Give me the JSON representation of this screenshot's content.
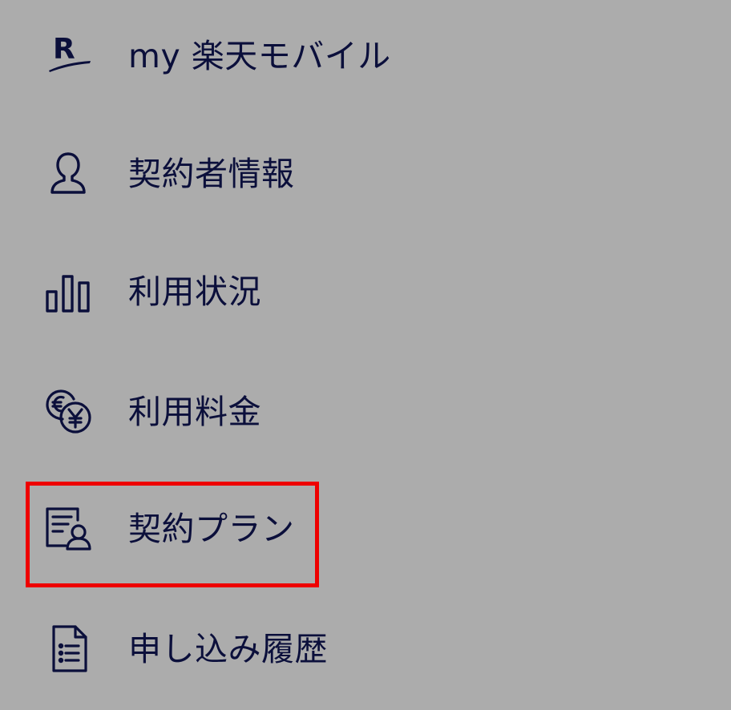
{
  "menu": {
    "items": [
      {
        "label": "my 楽天モバイル",
        "icon": "rakuten-logo-icon"
      },
      {
        "label": "契約者情報",
        "icon": "person-icon"
      },
      {
        "label": "利用状況",
        "icon": "bar-chart-icon"
      },
      {
        "label": "利用料金",
        "icon": "coins-yen-icon"
      },
      {
        "label": "契約プラン",
        "icon": "contract-plan-icon"
      },
      {
        "label": "申し込み履歴",
        "icon": "document-list-icon"
      }
    ],
    "highlighted_item": "契約プラン",
    "highlight_color": "#ee0000"
  },
  "colors": {
    "background": "#acacac",
    "text": "#0b0f3b"
  }
}
